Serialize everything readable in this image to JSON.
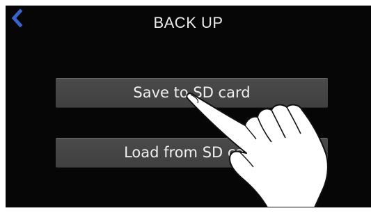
{
  "header": {
    "title": "BACK UP",
    "back_icon": "chevron-left-icon",
    "accent_color": "#3a63c9"
  },
  "menu": {
    "items": [
      {
        "label": "Save to SD card"
      },
      {
        "label": "Load from SD card"
      }
    ]
  },
  "overlay": {
    "icon": "pointing-hand-icon"
  }
}
